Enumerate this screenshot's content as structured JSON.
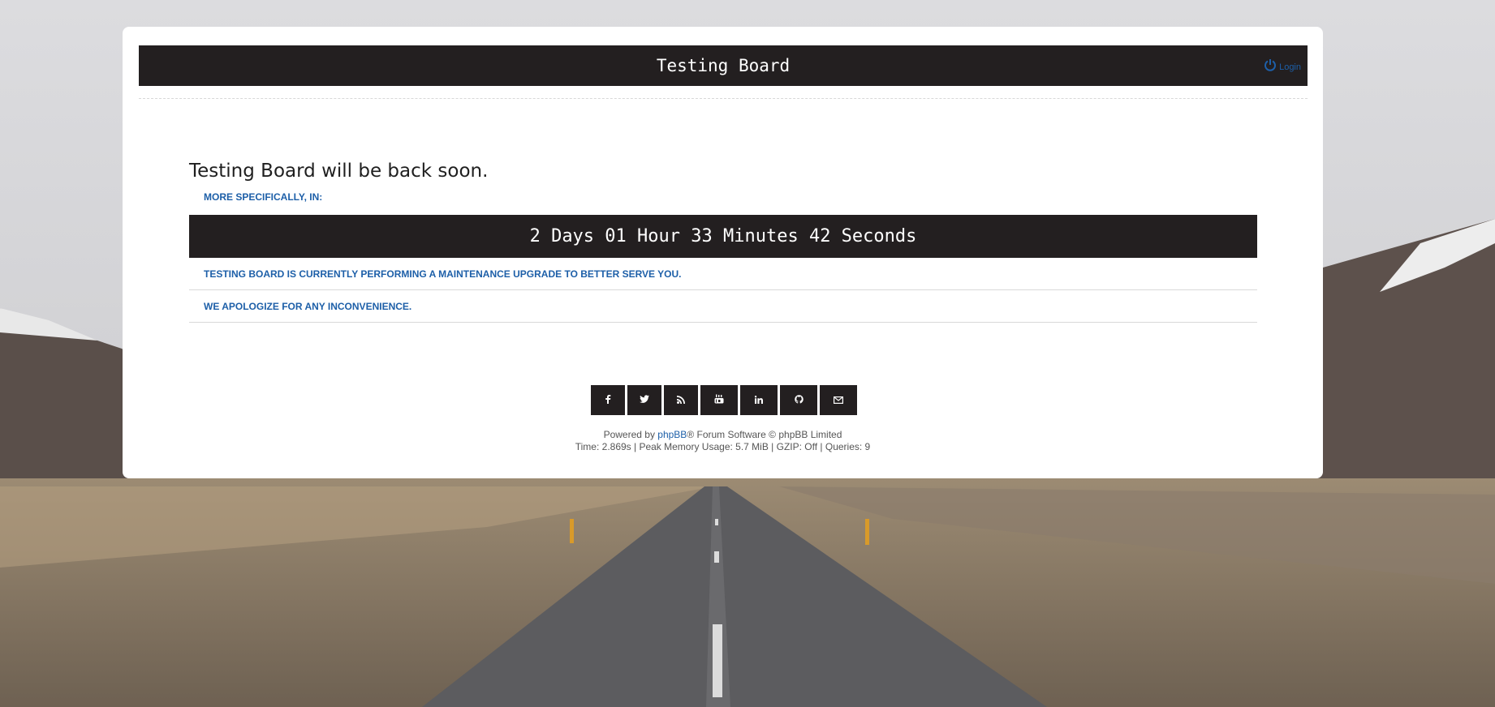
{
  "header": {
    "title": "Testing Board",
    "login_label": "Login"
  },
  "main": {
    "heading": "Testing Board will be back soon.",
    "caption": "MORE SPECIFICALLY, IN:",
    "countdown": "2 Days 01 Hour 33 Minutes 42 Seconds",
    "messages": [
      "TESTING BOARD IS CURRENTLY PERFORMING A MAINTENANCE UPGRADE TO BETTER SERVE YOU.",
      "WE APOLOGIZE FOR ANY INCONVENIENCE."
    ]
  },
  "social": [
    {
      "icon": "facebook-icon",
      "glyph": "f"
    },
    {
      "icon": "twitter-icon",
      "glyph": "t"
    },
    {
      "icon": "rss-icon",
      "glyph": "rss"
    },
    {
      "icon": "youtube-icon",
      "glyph": "yt"
    },
    {
      "icon": "linkedin-icon",
      "glyph": "in"
    },
    {
      "icon": "github-icon",
      "glyph": "gh"
    },
    {
      "icon": "email-icon",
      "glyph": "mail"
    }
  ],
  "footer": {
    "powered_prefix": "Powered by ",
    "phpbb_link": "phpBB",
    "powered_suffix": "® Forum Software © phpBB Limited",
    "stats": "Time: 2.869s | Peak Memory Usage: 5.7 MiB | GZIP: Off | Queries: 9"
  },
  "colors": {
    "dark": "#231f20",
    "accent": "#1d5fa8",
    "panel": "#ffffff"
  }
}
